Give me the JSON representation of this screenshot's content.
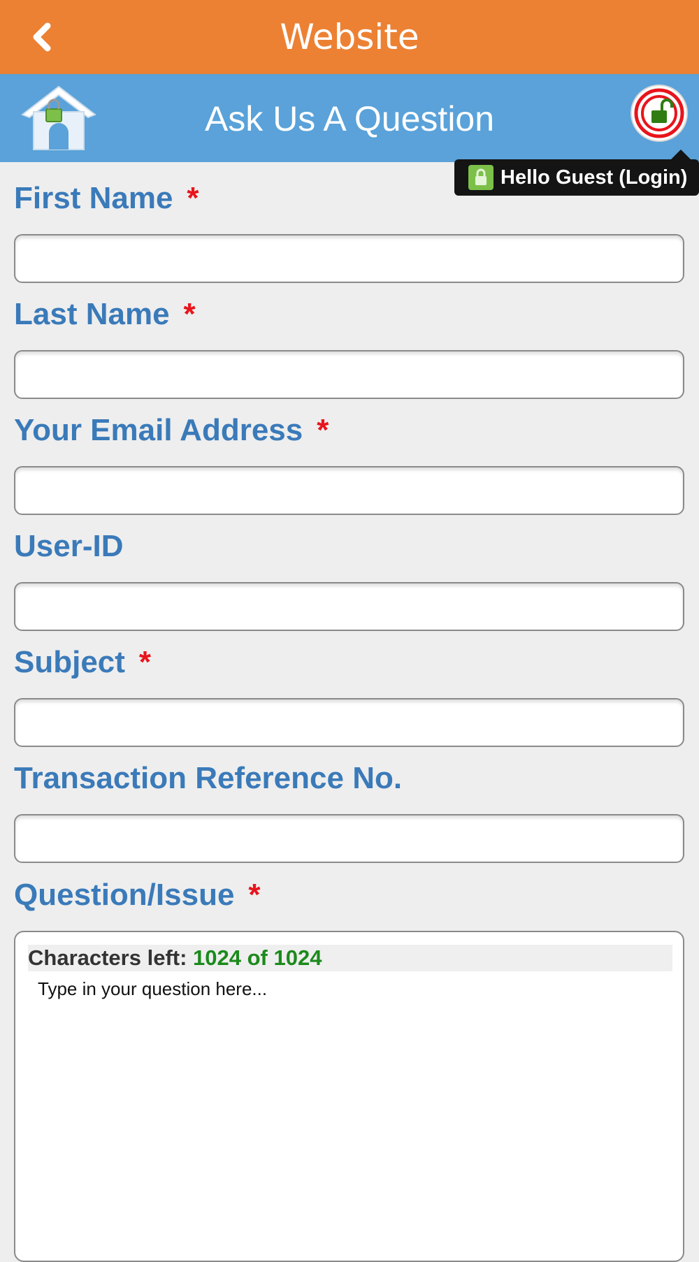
{
  "header": {
    "title": "Website",
    "back_icon": "chevron-left-icon",
    "color": "#ec8133"
  },
  "subheader": {
    "title": "Ask Us A Question",
    "home_icon": "home-lock-icon",
    "login_icon": "unlock-power-icon",
    "color": "#5aa2d9"
  },
  "login_tooltip": {
    "text": "Hello Guest (Login)",
    "icon": "lock-icon"
  },
  "form": {
    "required_marker": "*",
    "first_name": {
      "label": "First Name",
      "value": ""
    },
    "last_name": {
      "label": "Last Name",
      "value": ""
    },
    "email": {
      "label": "Your Email Address",
      "value": ""
    },
    "user_id": {
      "label": "User-ID",
      "value": ""
    },
    "subject": {
      "label": "Subject",
      "value": ""
    },
    "transaction_ref": {
      "label": "Transaction Reference No.",
      "value": ""
    },
    "question": {
      "label": "Question/Issue",
      "counter_label": "Characters left:",
      "counter_value": "1024 of 1024",
      "placeholder": "Type in your question here..."
    }
  },
  "colors": {
    "label": "#3a7ab9",
    "required": "#e8141c",
    "counter": "#1c8a1c"
  }
}
